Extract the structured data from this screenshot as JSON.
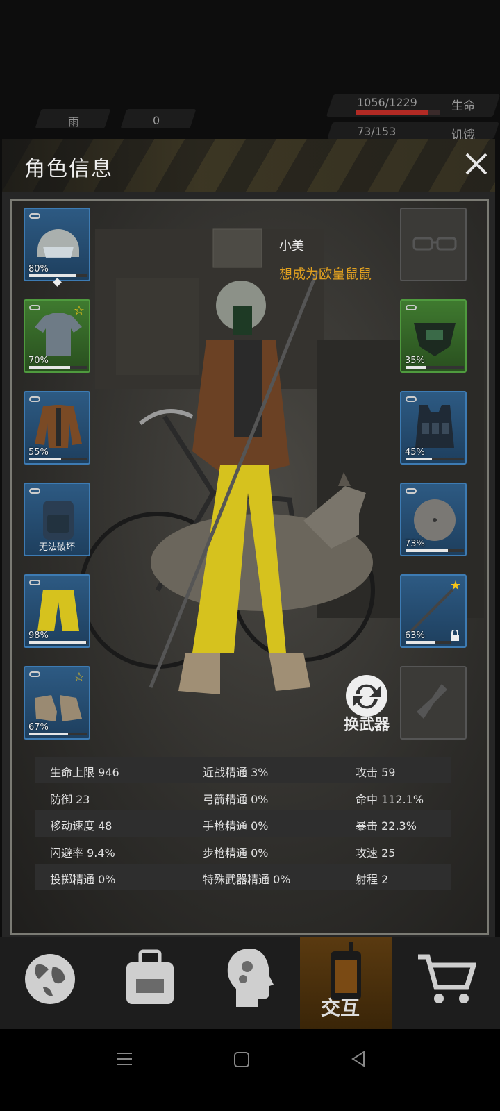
{
  "hud": {
    "weather": "雨",
    "radiation": "0",
    "health_text": "1056/1229",
    "health_label": "生命",
    "health_fraction": 0.86,
    "hunger_text": "73/153",
    "hunger_label": "饥饿"
  },
  "panel": {
    "title": "角色信息",
    "character_name": "小美",
    "character_subtitle": "想成为欧皇鼠鼠",
    "swap_weapon_label": "换武器"
  },
  "left_slots": [
    {
      "name": "helmet",
      "percent": "80%",
      "fill": 0.8,
      "color": "blue"
    },
    {
      "name": "shirt",
      "percent": "70%",
      "fill": 0.7,
      "color": "green",
      "star": true
    },
    {
      "name": "jacket",
      "percent": "55%",
      "fill": 0.55,
      "color": "blue"
    },
    {
      "name": "backpack",
      "label": "无法破坏",
      "color": "blue"
    },
    {
      "name": "pants",
      "percent": "98%",
      "fill": 0.98,
      "color": "blue"
    },
    {
      "name": "shoes",
      "percent": "67%",
      "fill": 0.67,
      "color": "blue",
      "star": true
    }
  ],
  "right_slots": [
    {
      "name": "glasses",
      "color": "empty"
    },
    {
      "name": "mask",
      "percent": "35%",
      "fill": 0.35,
      "color": "green"
    },
    {
      "name": "vest",
      "percent": "45%",
      "fill": 0.45,
      "color": "blue"
    },
    {
      "name": "shield",
      "percent": "73%",
      "fill": 0.73,
      "color": "blue"
    },
    {
      "name": "weapon",
      "percent": "63%",
      "fill": 0.63,
      "color": "blue",
      "star": true,
      "locked": true
    },
    {
      "name": "throwable",
      "color": "empty"
    }
  ],
  "stats": [
    [
      "生命上限 946",
      "近战精通 3%",
      "攻击 59"
    ],
    [
      "防御 23",
      "弓箭精通 0%",
      "命中 112.1%"
    ],
    [
      "移动速度 48",
      "手枪精通 0%",
      "暴击 22.3%"
    ],
    [
      "闪避率 9.4%",
      "步枪精通 0%",
      "攻速 25"
    ],
    [
      "投掷精通 0%",
      "特殊武器精通 0%",
      "射程 2"
    ]
  ],
  "nav": {
    "active_label": "交互",
    "icons": [
      "globe-icon",
      "backpack-icon",
      "head-gears-icon",
      "walkie-talkie-icon",
      "cart-icon"
    ]
  },
  "colors": {
    "slot_blue": "#2d5a83",
    "slot_green": "#3f7a2f",
    "subtitle": "#e0a020",
    "health_bar": "#b22a24"
  }
}
